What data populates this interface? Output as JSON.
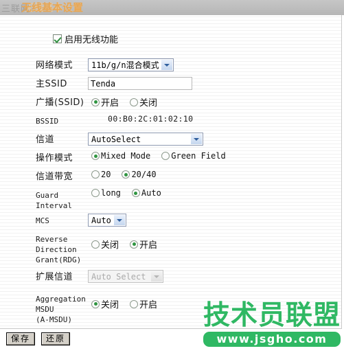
{
  "header": {
    "title": "无线基本设置",
    "ghost_title": "无线基本设置",
    "ghost_nav": "三联网"
  },
  "enable": {
    "label": "启用无线功能",
    "checked_icon": "checkbox-checked-icon"
  },
  "form": {
    "network_mode": {
      "label": "网络模式",
      "value": "11b/g/n混合模式",
      "icon": "chevron-down-icon"
    },
    "primary_ssid": {
      "label": "主SSID",
      "value": "Tenda",
      "placeholder": ""
    },
    "broadcast_ssid": {
      "label": "广播(SSID)",
      "options": [
        "开启",
        "关闭"
      ],
      "selected": "开启"
    },
    "bssid": {
      "label": "BSSID",
      "value": "00:B0:2C:01:02:10"
    },
    "channel": {
      "label": "信道",
      "value": "AutoSelect",
      "icon": "chevron-down-icon"
    },
    "operation_mode": {
      "label": "操作模式",
      "options": [
        "Mixed Mode",
        "Green Field"
      ],
      "selected": "Mixed Mode"
    },
    "channel_bandwidth": {
      "label": "信道带宽",
      "options": [
        "20",
        "20/40"
      ],
      "selected": "20/40"
    },
    "guard_interval": {
      "label": "Guard Interval",
      "options": [
        "long",
        "Auto"
      ],
      "selected": "Auto"
    },
    "mcs": {
      "label": "MCS",
      "value": "Auto",
      "icon": "chevron-down-icon"
    },
    "rdg": {
      "label": "Reverse Direction\nGrant(RDG)",
      "options": [
        "关闭",
        "开启"
      ],
      "selected": "开启"
    },
    "extension_channel": {
      "label": "扩展信道",
      "value": "Auto Select",
      "disabled": true,
      "icon": "chevron-down-icon"
    },
    "amsdu": {
      "label": "Aggregation MSDU\n(A-MSDU)",
      "options": [
        "关闭",
        "开启"
      ],
      "selected": "关闭"
    }
  },
  "footer": {
    "save_label": "保存",
    "reset_label": "还原"
  },
  "watermark": {
    "main": "技术员联盟",
    "url": "www.jsgho.com",
    "color": "#2fb863"
  }
}
